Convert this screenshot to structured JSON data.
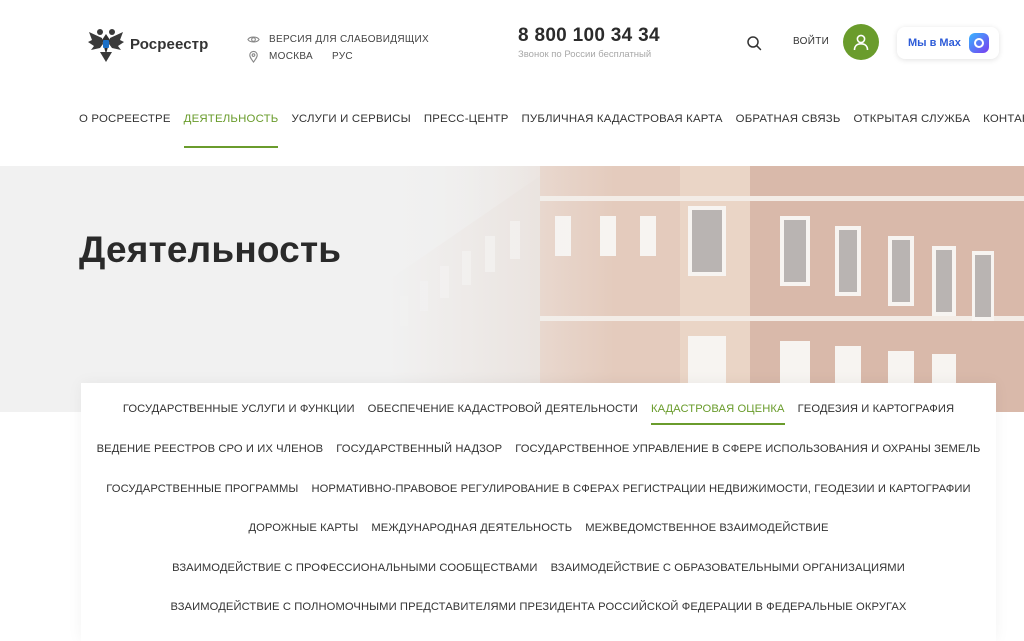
{
  "header": {
    "logo_text": "Росреестр",
    "accessibility_label": "ВЕРСИЯ ДЛЯ СЛАБОВИДЯЩИХ",
    "city": "МОСКВА",
    "language": "РУС",
    "phone": "8 800 100 34 34",
    "phone_note": "Звонок по России бесплатный",
    "login_label": "ВОЙТИ",
    "max_label": "Мы в Max",
    "accent_color": "#6a9c2c"
  },
  "nav": {
    "items": [
      "О РОСРЕЕСТРЕ",
      "ДЕЯТЕЛЬНОСТЬ",
      "УСЛУГИ И СЕРВИСЫ",
      "ПРЕСС-ЦЕНТР",
      "ПУБЛИЧНАЯ КАДАСТРОВАЯ КАРТА",
      "ОБРАТНАЯ СВЯЗЬ",
      "ОТКРЫТАЯ СЛУЖБА",
      "КОНТАКТЫ"
    ],
    "active": "ДЕЯТЕЛЬНОСТЬ"
  },
  "hero": {
    "title": "Деятельность"
  },
  "subnav": {
    "rows": [
      [
        "ГОСУДАРСТВЕННЫЕ УСЛУГИ И ФУНКЦИИ",
        "ОБЕСПЕЧЕНИЕ КАДАСТРОВОЙ ДЕЯТЕЛЬНОСТИ",
        "КАДАСТРОВАЯ ОЦЕНКА",
        "ГЕОДЕЗИЯ И КАРТОГРАФИЯ"
      ],
      [
        "ВЕДЕНИЕ РЕЕСТРОВ СРО И ИХ ЧЛЕНОВ",
        "ГОСУДАРСТВЕННЫЙ НАДЗОР",
        "ГОСУДАРСТВЕННОЕ УПРАВЛЕНИЕ В СФЕРЕ ИСПОЛЬЗОВАНИЯ И ОХРАНЫ ЗЕМЕЛЬ"
      ],
      [
        "ГОСУДАРСТВЕННЫЕ ПРОГРАММЫ",
        "НОРМАТИВНО-ПРАВОВОЕ РЕГУЛИРОВАНИЕ В СФЕРАХ РЕГИСТРАЦИИ НЕДВИЖИМОСТИ, ГЕОДЕЗИИ И КАРТОГРАФИИ"
      ],
      [
        "ДОРОЖНЫЕ КАРТЫ",
        "МЕЖДУНАРОДНАЯ ДЕЯТЕЛЬНОСТЬ",
        "МЕЖВЕДОМСТВЕННОЕ ВЗАИМОДЕЙСТВИЕ"
      ],
      [
        "ВЗАИМОДЕЙСТВИЕ С ПРОФЕССИОНАЛЬНЫМИ СООБЩЕСТВАМИ",
        "ВЗАИМОДЕЙСТВИЕ С ОБРАЗОВАТЕЛЬНЫМИ ОРГАНИЗАЦИЯМИ"
      ],
      [
        "ВЗАИМОДЕЙСТВИЕ С ПОЛНОМОЧНЫМИ ПРЕДСТАВИТЕЛЯМИ ПРЕЗИДЕНТА РОССИЙСКОЙ ФЕДЕРАЦИИ В ФЕДЕРАЛЬНЫЕ ОКРУГАХ"
      ]
    ],
    "active": "КАДАСТРОВАЯ ОЦЕНКА"
  }
}
